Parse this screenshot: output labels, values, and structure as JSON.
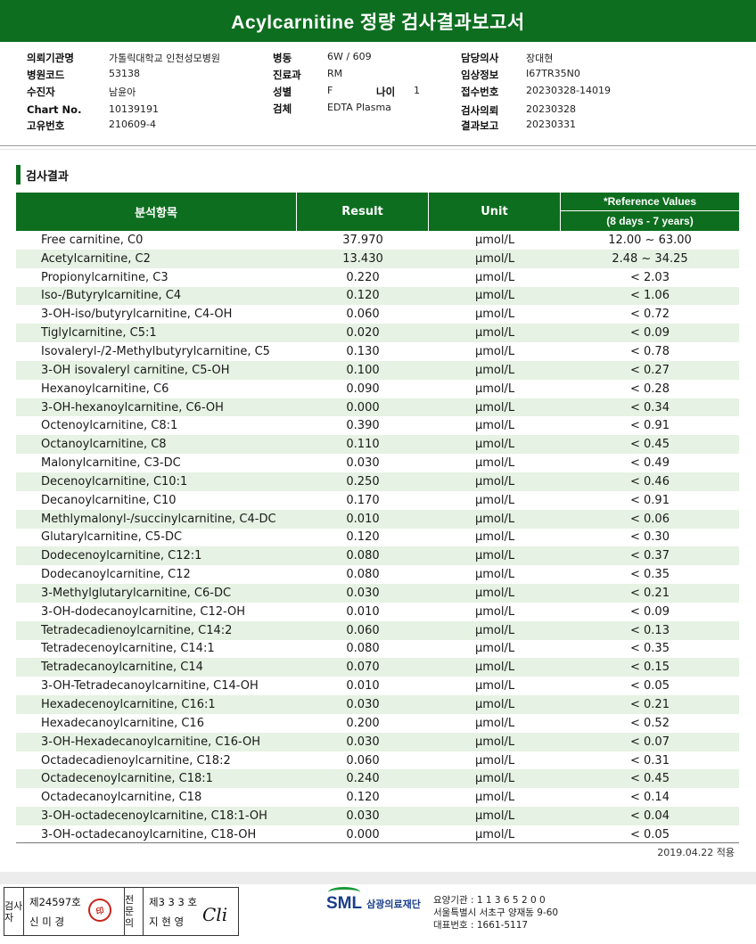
{
  "title": "Acylcarnitine 정량 검사결과보고서",
  "info": {
    "col1": [
      {
        "label": "의뢰기관명",
        "value": "가톨릭대학교 인천성모병원"
      },
      {
        "label": "병원코드",
        "value": "53138"
      },
      {
        "label": "수진자",
        "value": "남윤아"
      },
      {
        "label": "Chart No.",
        "value": "10139191"
      },
      {
        "label": "고유번호",
        "value": "210609-4"
      }
    ],
    "col2": [
      {
        "label": "병동",
        "value": "6W / 609"
      },
      {
        "label": "진료과",
        "value": "RM"
      },
      {
        "label": "성별",
        "value": "F"
      },
      {
        "label": "검체",
        "value": "EDTA Plasma"
      }
    ],
    "age": {
      "label": "나이",
      "value": "1"
    },
    "col3": [
      {
        "label": "담당의사",
        "value": "장대현"
      },
      {
        "label": "임상정보",
        "value": "I67TR35N0"
      },
      {
        "label": "접수번호",
        "value": "20230328-14019"
      },
      {
        "label": "검사의뢰",
        "value": "20230328"
      },
      {
        "label": "결과보고",
        "value": "20230331"
      }
    ]
  },
  "section_title": "검사결과",
  "table": {
    "headers": {
      "item": "분석항목",
      "result": "Result",
      "unit": "Unit",
      "ref_top": "*Reference Values",
      "ref_bottom": "(8 days - 7 years)"
    },
    "rows": [
      {
        "name": "Free carnitine, C0",
        "result": "37.970",
        "unit": "μmol/L",
        "ref": "12.00 ~ 63.00"
      },
      {
        "name": "Acetylcarnitine, C2",
        "result": "13.430",
        "unit": "μmol/L",
        "ref": "2.48 ~ 34.25"
      },
      {
        "name": "Propionylcarnitine, C3",
        "result": "0.220",
        "unit": "μmol/L",
        "ref": "< 2.03"
      },
      {
        "name": "Iso-/Butyrylcarnitine, C4",
        "result": "0.120",
        "unit": "μmol/L",
        "ref": "< 1.06"
      },
      {
        "name": "3-OH-iso/butyrylcarnitine, C4-OH",
        "result": "0.060",
        "unit": "μmol/L",
        "ref": "< 0.72"
      },
      {
        "name": "Tiglylcarnitine, C5:1",
        "result": "0.020",
        "unit": "μmol/L",
        "ref": "< 0.09"
      },
      {
        "name": "Isovaleryl-/2-Methylbutyrylcarnitine, C5",
        "result": "0.130",
        "unit": "μmol/L",
        "ref": "< 0.78"
      },
      {
        "name": "3-OH isovaleryl carnitine, C5-OH",
        "result": "0.100",
        "unit": "μmol/L",
        "ref": "< 0.27"
      },
      {
        "name": "Hexanoylcarnitine, C6",
        "result": "0.090",
        "unit": "μmol/L",
        "ref": "< 0.28"
      },
      {
        "name": "3-OH-hexanoylcarnitine, C6-OH",
        "result": "0.000",
        "unit": "μmol/L",
        "ref": "< 0.34"
      },
      {
        "name": "Octenoylcarnitine, C8:1",
        "result": "0.390",
        "unit": "μmol/L",
        "ref": "< 0.91"
      },
      {
        "name": "Octanoylcarnitine, C8",
        "result": "0.110",
        "unit": "μmol/L",
        "ref": "< 0.45"
      },
      {
        "name": "Malonylcarnitine, C3-DC",
        "result": "0.030",
        "unit": "μmol/L",
        "ref": "< 0.49"
      },
      {
        "name": "Decenoylcarnitine, C10:1",
        "result": "0.250",
        "unit": "μmol/L",
        "ref": "< 0.46"
      },
      {
        "name": "Decanoylcarnitine, C10",
        "result": "0.170",
        "unit": "μmol/L",
        "ref": "< 0.91"
      },
      {
        "name": "Methlymalonyl-/succinylcarnitine, C4-DC",
        "result": "0.010",
        "unit": "μmol/L",
        "ref": "< 0.06"
      },
      {
        "name": "Glutarylcarnitine, C5-DC",
        "result": "0.120",
        "unit": "μmol/L",
        "ref": "< 0.30"
      },
      {
        "name": "Dodecenoylcarnitine, C12:1",
        "result": "0.080",
        "unit": "μmol/L",
        "ref": "< 0.37"
      },
      {
        "name": "Dodecanoylcarnitine, C12",
        "result": "0.080",
        "unit": "μmol/L",
        "ref": "< 0.35"
      },
      {
        "name": "3-Methylglutarylcarnitine, C6-DC",
        "result": "0.030",
        "unit": "μmol/L",
        "ref": "< 0.21"
      },
      {
        "name": "3-OH-dodecanoylcarnitine, C12-OH",
        "result": "0.010",
        "unit": "μmol/L",
        "ref": "< 0.09"
      },
      {
        "name": "Tetradecadienoylcarnitine, C14:2",
        "result": "0.060",
        "unit": "μmol/L",
        "ref": "< 0.13"
      },
      {
        "name": "Tetradecenoylcarnitine, C14:1",
        "result": "0.080",
        "unit": "μmol/L",
        "ref": "< 0.35"
      },
      {
        "name": "Tetradecanoylcarnitine, C14",
        "result": "0.070",
        "unit": "μmol/L",
        "ref": "< 0.15"
      },
      {
        "name": "3-OH-Tetradecanoylcarnitine, C14-OH",
        "result": "0.010",
        "unit": "μmol/L",
        "ref": "< 0.05"
      },
      {
        "name": "Hexadecenoylcarnitine, C16:1",
        "result": "0.030",
        "unit": "μmol/L",
        "ref": "< 0.21"
      },
      {
        "name": "Hexadecanoylcarnitine, C16",
        "result": "0.200",
        "unit": "μmol/L",
        "ref": "< 0.52"
      },
      {
        "name": "3-OH-Hexadecanoylcarnitine, C16-OH",
        "result": "0.030",
        "unit": "μmol/L",
        "ref": "< 0.07"
      },
      {
        "name": "Octadecadienoylcarnitine, C18:2",
        "result": "0.060",
        "unit": "μmol/L",
        "ref": "< 0.31"
      },
      {
        "name": "Octadecenoylcarnitine, C18:1",
        "result": "0.240",
        "unit": "μmol/L",
        "ref": "< 0.45"
      },
      {
        "name": "Octadecanoylcarnitine, C18",
        "result": "0.120",
        "unit": "μmol/L",
        "ref": "< 0.14"
      },
      {
        "name": "3-OH-octadecenoylcarnitine, C18:1-OH",
        "result": "0.030",
        "unit": "μmol/L",
        "ref": "< 0.04"
      },
      {
        "name": "3-OH-octadecanoylcarnitine, C18-OH",
        "result": "0.000",
        "unit": "μmol/L",
        "ref": "< 0.05"
      }
    ]
  },
  "note": "2019.04.22 적용",
  "signatures": {
    "box1_label": "검사자",
    "box1_no": "제24597호",
    "box1_name": "신 미 경",
    "box1_stamp": "印",
    "box2_label": "전문의",
    "box2_no": "제3 3 3 호",
    "box2_name": "지 현 영",
    "box2_sign": "Cli"
  },
  "logo": {
    "mark": "SML",
    "name": "삼광의료재단"
  },
  "org": {
    "code": "요양기관 : 1 1 3 6 5 2 0 0",
    "address": "서울특별시 서초구 양재동 9-60",
    "phone": "대표번호 : 1661-5117"
  },
  "colors": {
    "brand_green": "#0d6e1f",
    "alt_row": "#e6f2e3",
    "stamp_red": "#c8281e",
    "logo_blue": "#1a3e8a"
  }
}
